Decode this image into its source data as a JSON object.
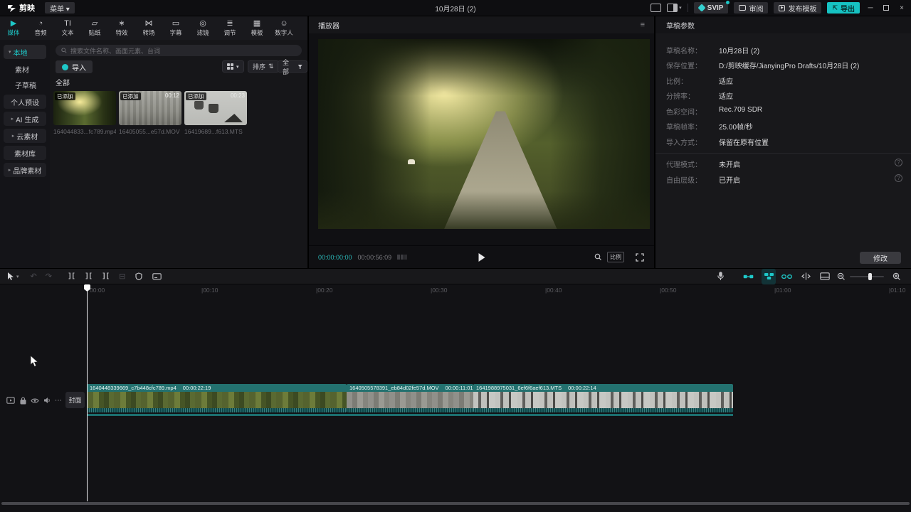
{
  "app": {
    "logo_text": "剪映",
    "menu_label": "菜单 ▾",
    "window_title": "10月28日 (2)",
    "svip_label": "SVIP",
    "review_label": "审阅",
    "publish_label": "发布模板",
    "export_label": "导出",
    "accent_color": "#1ec8c8"
  },
  "media_panel": {
    "tabs": [
      {
        "label": "媒体",
        "glyph": "▶"
      },
      {
        "label": "音频",
        "glyph": "◔"
      },
      {
        "label": "文本",
        "glyph": "TI"
      },
      {
        "label": "贴纸",
        "glyph": "▱"
      },
      {
        "label": "特效",
        "glyph": "∗"
      },
      {
        "label": "转场",
        "glyph": "⋈"
      },
      {
        "label": "字幕",
        "glyph": "▭"
      },
      {
        "label": "滤镜",
        "glyph": "◎"
      },
      {
        "label": "调节",
        "glyph": "≣"
      },
      {
        "label": "模板",
        "glyph": "▦"
      },
      {
        "label": "数字人",
        "glyph": "☺"
      }
    ],
    "sidebar": [
      {
        "label": "本地"
      },
      {
        "label": "素材"
      },
      {
        "label": "子草稿"
      },
      {
        "label": "个人预设"
      },
      {
        "label": "AI 生成"
      },
      {
        "label": "云素材"
      },
      {
        "label": "素材库"
      },
      {
        "label": "品牌素材"
      }
    ],
    "search_placeholder": "搜索文件名称、画面元素、台词",
    "import_label": "导入",
    "sort_label": "排序",
    "filter_label": "全部",
    "section_label": "全部",
    "items": [
      {
        "badge": "已添加",
        "duration": "",
        "name": "164044833...fc789.mp4"
      },
      {
        "badge": "已添加",
        "duration": "00:12",
        "name": "16405055...e57d.MOV"
      },
      {
        "badge": "已添加",
        "duration": "00:23",
        "name": "16419689...f613.MTS"
      }
    ]
  },
  "player": {
    "title": "播放器",
    "current_time": "00:00:00:00",
    "total_time": "00:00:56:09",
    "ratio_label": "比例"
  },
  "draft_panel": {
    "title": "草稿参数",
    "rows": [
      {
        "label": "草稿名称：",
        "value": "10月28日 (2)"
      },
      {
        "label": "保存位置：",
        "value": "D:/剪映缓存/JianyingPro Drafts/10月28日 (2)"
      },
      {
        "label": "比例：",
        "value": "适应"
      },
      {
        "label": "分辨率：",
        "value": "适应"
      },
      {
        "label": "色彩空间：",
        "value": "Rec.709 SDR"
      },
      {
        "label": "草稿帧率：",
        "value": "25.00帧/秒"
      },
      {
        "label": "导入方式：",
        "value": "保留在原有位置"
      },
      {
        "label": "代理模式：",
        "value": "未开启"
      },
      {
        "label": "自由层级：",
        "value": "已开启"
      }
    ],
    "modify_label": "修改"
  },
  "timeline": {
    "ruler": [
      "00:00",
      "|00:10",
      "|00:20",
      "|00:30",
      "|00:40",
      "|00:50",
      "|01:00",
      "|01:10"
    ],
    "cover_label": "封面",
    "clips": [
      {
        "name": "1640448339669_c7b448cfc789.mp4",
        "duration": "00:00:22:19"
      },
      {
        "name": "1640505578391_eb84d02fe57d.MOV",
        "duration": "00:00:11:01"
      },
      {
        "name": "1641988975031_6ef6f6aef613.MTS",
        "duration": "00:00:22:14"
      }
    ]
  }
}
